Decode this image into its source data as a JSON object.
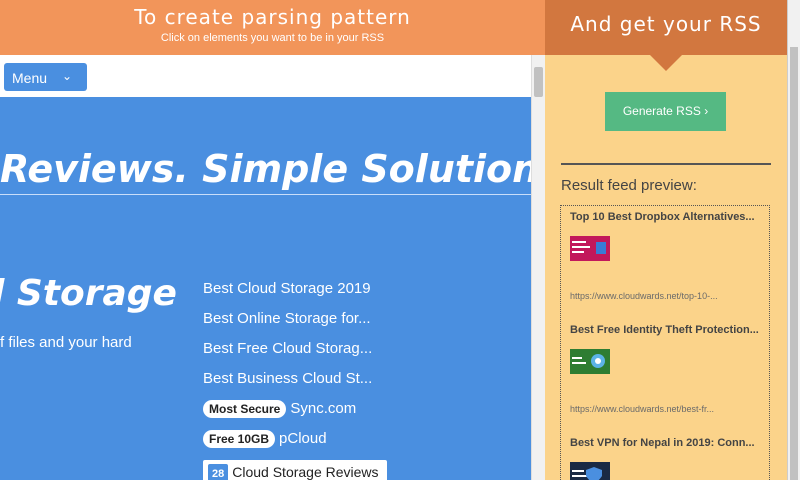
{
  "header": {
    "title": "To create parsing pattern",
    "subtitle": "Click on elements you want to be in your RSS"
  },
  "site": {
    "menu_label": "Menu",
    "hero": "Reviews. Simple Solutions.",
    "storage_title": "l Storage",
    "storage_sub": "f files and your hard",
    "links": [
      "Best Cloud Storage 2019",
      "Best Online Storage for...",
      "Best Free Cloud Storag...",
      "Best Business Cloud St..."
    ],
    "badge_links": [
      {
        "badge": "Most Secure",
        "label": "Sync.com"
      },
      {
        "badge": "Free 10GB",
        "label": "pCloud"
      }
    ],
    "reviews_count": "28",
    "reviews_label": "Cloud Storage Reviews"
  },
  "right": {
    "title": "And get your RSS",
    "generate_label": "Generate RSS ›",
    "preview_label": "Result feed preview:",
    "feed": [
      {
        "title": "Top 10 Best Dropbox Alternatives...",
        "url": "https://www.cloudwards.net/top-10-...",
        "thumb_color": "#c2185b"
      },
      {
        "title": "Best Free Identity Theft Protection...",
        "url": "https://www.cloudwards.net/best-fr...",
        "thumb_color": "#2e7d32"
      },
      {
        "title": "Best VPN for Nepal in 2019: Conn...",
        "url": "",
        "thumb_color": "#1a2a44"
      }
    ]
  },
  "colors": {
    "header_orange": "#f2955a",
    "accent_blue": "#4a8fe0",
    "panel_yellow": "#fbd38a",
    "button_green": "#55b983"
  }
}
